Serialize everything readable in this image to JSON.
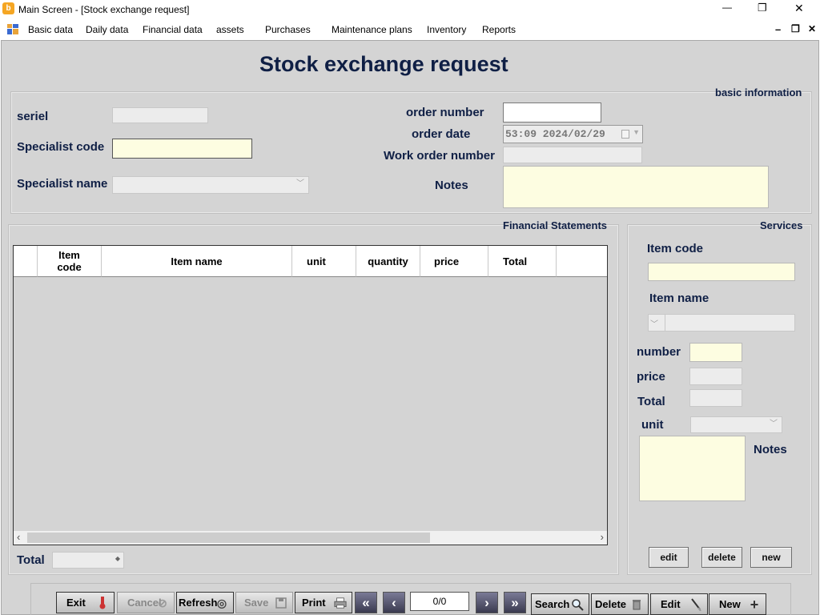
{
  "window": {
    "title": "Main Screen - [Stock exchange request]",
    "controls": {
      "minimize": "—",
      "restore": "❐",
      "close": "✕"
    },
    "mdi_controls": {
      "minimize": "–",
      "restore": "❐",
      "close": "✕"
    }
  },
  "menu": {
    "items": [
      "Basic data",
      "Daily data",
      "Financial data",
      "assets",
      "Purchases",
      "Maintenance plans",
      "Inventory",
      "Reports"
    ]
  },
  "form": {
    "title": "Stock exchange request",
    "basic_info": {
      "group_label": "basic information",
      "seriel_label": "seriel",
      "seriel_value": "",
      "specialist_code_label": "Specialist code",
      "specialist_code_value": "",
      "specialist_name_label": "Specialist name",
      "specialist_name_value": "",
      "order_number_label": "order number",
      "order_number_value": "",
      "order_date_label": "order date",
      "order_date_value": "53:09 2024/02/29",
      "work_order_number_label": "Work order number",
      "work_order_number_value": "",
      "notes_label": "Notes",
      "notes_value": ""
    },
    "financial": {
      "group_label": "Financial Statements",
      "columns": [
        "Item code",
        "Item name",
        "unit",
        "quantity",
        "price",
        "Total"
      ],
      "rows": [],
      "total_label": "Total",
      "total_value": ""
    },
    "services": {
      "group_label": "Services",
      "item_code_label": "Item code",
      "item_code_value": "",
      "item_name_label": "Item name",
      "item_name_value": "",
      "number_label": "number",
      "number_value": "",
      "price_label": "price",
      "price_value": "",
      "total_label": "Total",
      "total_value": "",
      "unit_label": "unit",
      "unit_value": "",
      "notes_label": "Notes",
      "notes_value": "",
      "edit_button": "edit",
      "delete_button": "delete",
      "new_button": "new"
    }
  },
  "toolbar": {
    "exit": "Exit",
    "cancel": "Cancel",
    "refresh": "Refresh",
    "save": "Save",
    "print": "Print",
    "record_position": "0/0",
    "search": "Search",
    "delete": "Delete",
    "edit": "Edit",
    "new": "New"
  },
  "colors": {
    "background": "#d4d4d4",
    "title_text": "#0f1f45",
    "required_field": "#fdfde1"
  }
}
